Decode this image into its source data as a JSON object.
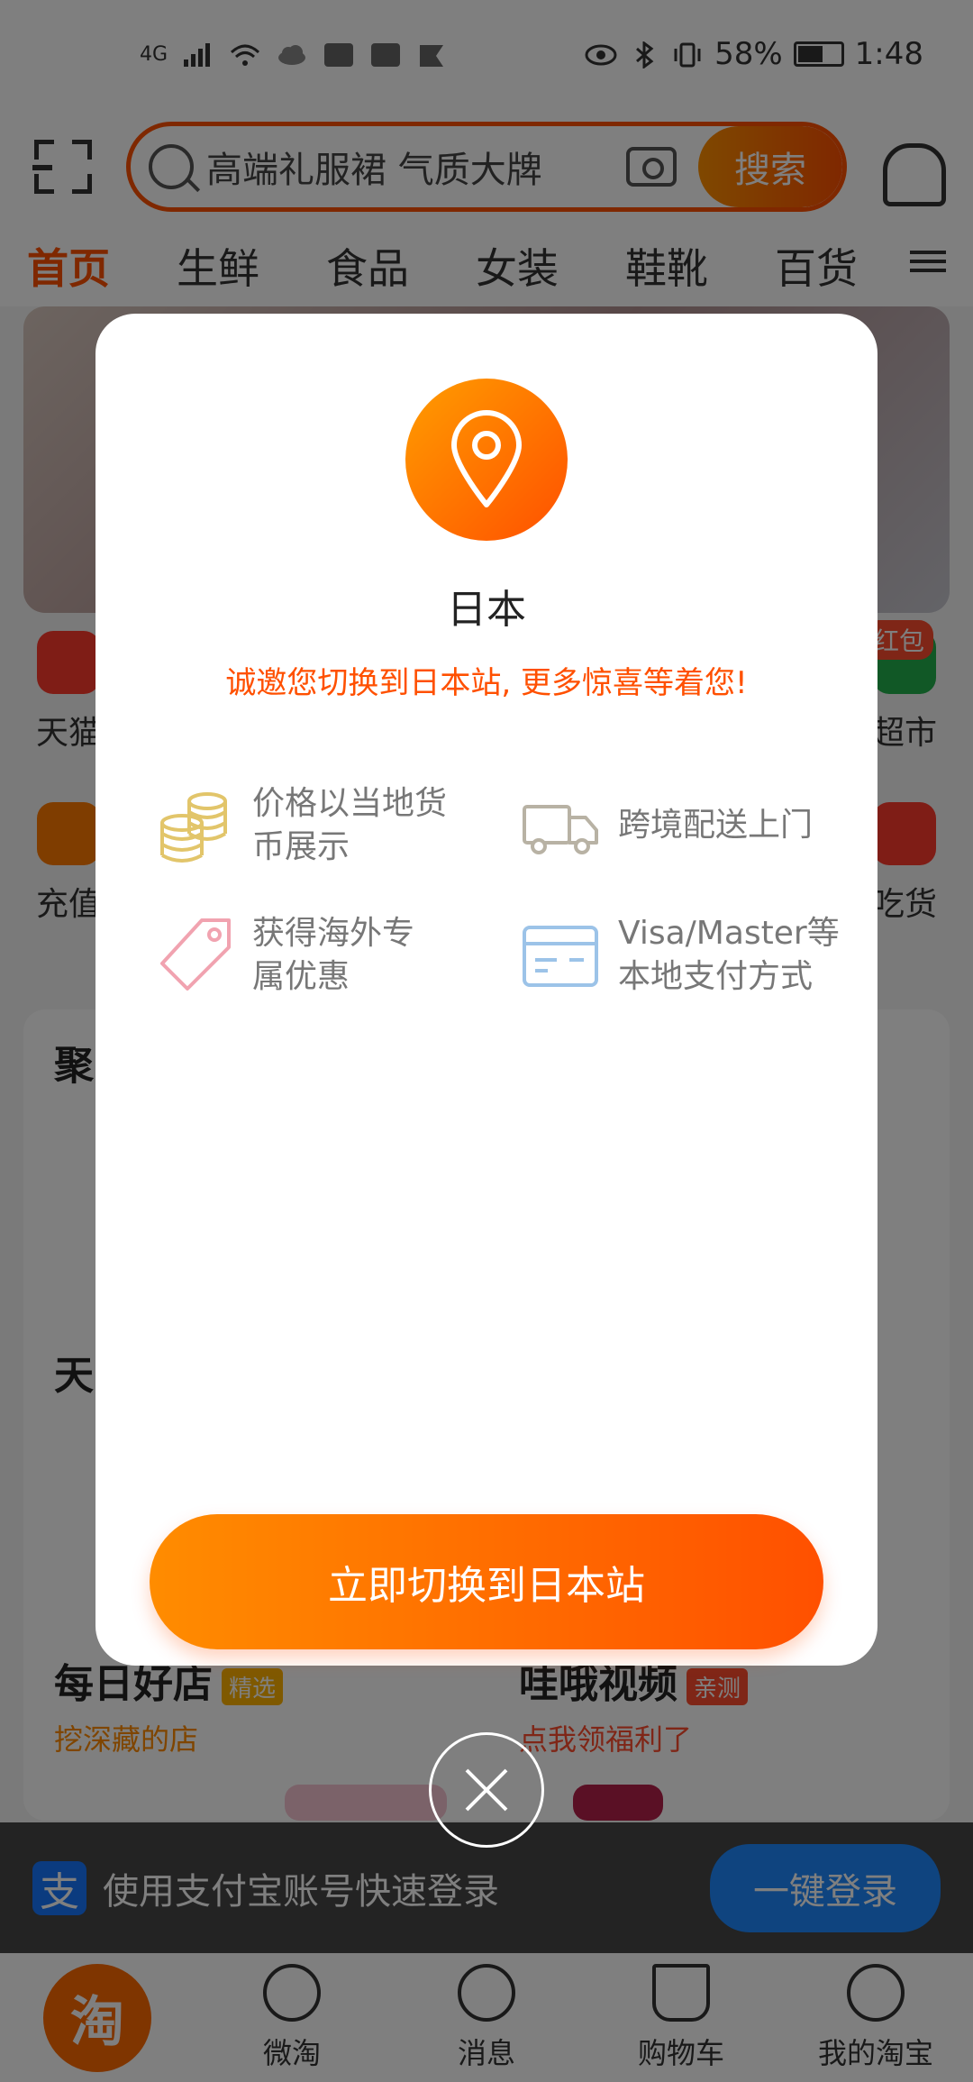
{
  "status_bar": {
    "network": "4G",
    "battery_percent": "58%",
    "time": "1:48"
  },
  "header": {
    "search_placeholder": "高端礼服裙 气质大牌",
    "search_button": "搜索"
  },
  "tabs": [
    "首页",
    "生鲜",
    "食品",
    "女装",
    "鞋靴",
    "百货"
  ],
  "quick_row_1": [
    "天猫",
    "超市"
  ],
  "quick_row_2": [
    "充值",
    "吃货"
  ],
  "red_packet_label": "红包",
  "sections": {
    "juhuasuan": {
      "title": "聚"
    },
    "tmall": {
      "title": "天"
    },
    "daily_store": {
      "title": "每日好店",
      "tag": "精选",
      "subtitle": "挖深藏的店"
    },
    "video": {
      "title": "哇哦视频",
      "tag": "亲测",
      "subtitle": "点我领福利了"
    }
  },
  "alipay": {
    "text": "使用支付宝账号快速登录",
    "button": "一键登录"
  },
  "bottom_nav": [
    "淘",
    "微淘",
    "消息",
    "购物车",
    "我的淘宝"
  ],
  "modal": {
    "title": "日本",
    "subtitle": "诚邀您切换到日本站, 更多惊喜等着您!",
    "benefits": [
      {
        "line1": "价格以当地货",
        "line2": "币展示",
        "icon": "coins-icon"
      },
      {
        "line1": "跨境配送上门",
        "line2": "",
        "icon": "truck-icon"
      },
      {
        "line1": "获得海外专",
        "line2": "属优惠",
        "icon": "tag-icon"
      },
      {
        "line1": "Visa/Master等",
        "line2": "本地支付方式",
        "icon": "card-icon"
      }
    ],
    "primary_button": "立即切换到日本站"
  },
  "colors": {
    "accent": "#ff5000",
    "accent_light": "#ff9000",
    "alipay_blue": "#1677ff"
  }
}
